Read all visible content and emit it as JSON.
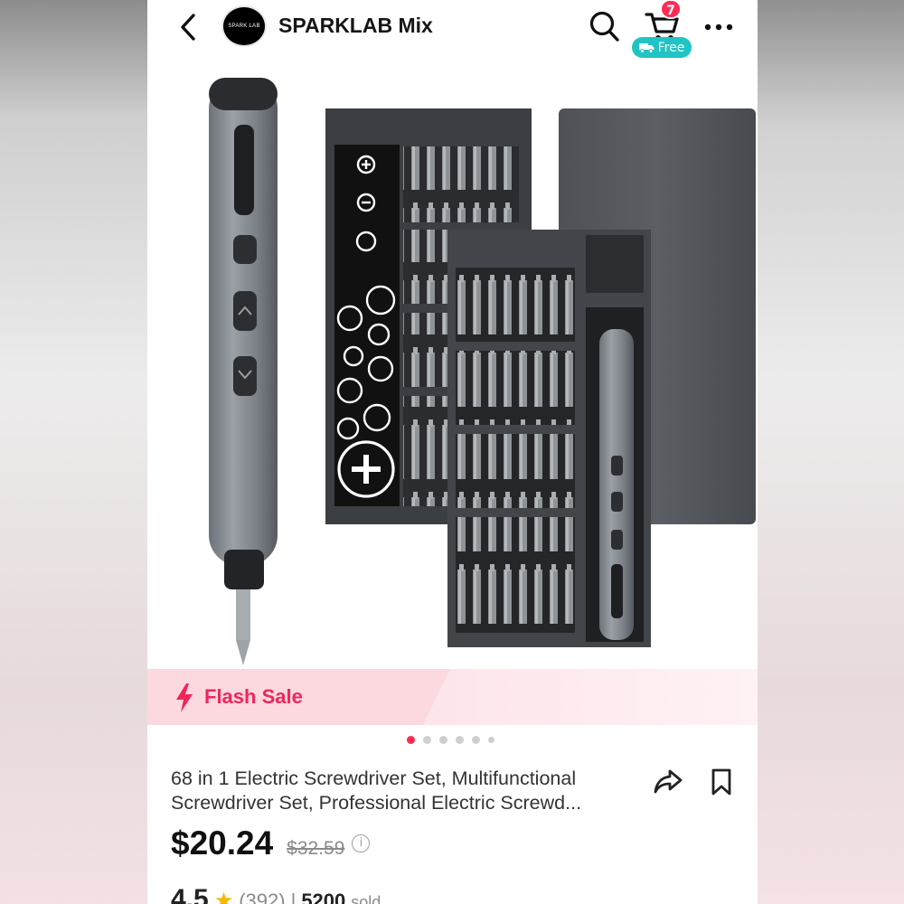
{
  "header": {
    "shop_logo_text": "SPARK LAB",
    "shop_name": "SPARKLAB Mix",
    "cart_count": "7",
    "free_label": "Free",
    "icons": [
      "back-icon",
      "search-icon",
      "cart-icon",
      "truck-icon",
      "more-icon"
    ]
  },
  "flash_sale": {
    "label": "Flash Sale",
    "icon": "lightning-icon"
  },
  "carousel": {
    "total": 6,
    "active_index": 0
  },
  "product": {
    "title": "68 in 1 Electric Screwdriver Set, Multifunctional Screwdriver Set, Professional Electric Screwd...",
    "price": "$20.24",
    "original_price": "$32.59",
    "rating": "4.5",
    "review_count": "(392)",
    "separator": "|",
    "sold_count": "5200",
    "sold_label": "sold"
  },
  "colors": {
    "accent": "#fe2c55",
    "free_badge": "#20c4c4",
    "flash_text": "#f0265a",
    "star": "#f5b800"
  }
}
